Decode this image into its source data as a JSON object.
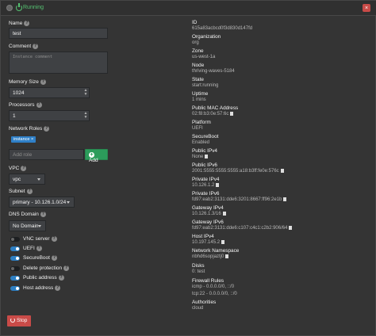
{
  "header": {
    "status": "Running",
    "delete_glyph": "×"
  },
  "form": {
    "name_label": "Name",
    "name_value": "test",
    "comment_label": "Comment",
    "comment_placeholder": "Instance comment",
    "memory_label": "Memory Size",
    "memory_value": "1024",
    "processors_label": "Processors",
    "processors_value": "1",
    "network_roles_label": "Network Roles",
    "role_tag": "instance",
    "role_tag_close": "×",
    "add_role_placeholder": "Add role",
    "add_label": "Add",
    "vpc_label": "VPC",
    "vpc_value": "vpc",
    "subnet_label": "Subnet",
    "subnet_value": "primary - 10.126.1.0/24",
    "dns_domain_label": "DNS Domain",
    "dns_domain_value": "No Domain",
    "toggles": [
      {
        "label": "VNC server",
        "on": false
      },
      {
        "label": "UEFI",
        "on": true
      },
      {
        "label": "SecureBoot",
        "on": true
      },
      {
        "label": "Delete protection",
        "on": false
      },
      {
        "label": "Public address",
        "on": true
      },
      {
        "label": "Host address",
        "on": true
      }
    ],
    "stop_label": "Stop"
  },
  "info": [
    {
      "label": "ID",
      "value": "615a83acbcd0f3d830d147fd"
    },
    {
      "label": "Organization",
      "value": "org"
    },
    {
      "label": "Zone",
      "value": "us-west-1a"
    },
    {
      "label": "Node",
      "value": "thriving-waves-5184"
    },
    {
      "label": "State",
      "value": "start:running"
    },
    {
      "label": "Uptime",
      "value": "1 mins"
    },
    {
      "label": "Public MAC Address",
      "value": "02:f8:b3:0e:57:6c"
    },
    {
      "label": "Platform",
      "value": "UEFI"
    },
    {
      "label": "SecureBoot",
      "value": "Enabled"
    },
    {
      "label": "Public IPv4",
      "value": "None"
    },
    {
      "label": "Public IPv6",
      "value": "2001:5555:5555:5555:a18:b3ff:fe0e:576c"
    },
    {
      "label": "Private IPv4",
      "value": "10.126.1.2"
    },
    {
      "label": "Private IPv6",
      "value": "fd97:eab2:3131:dde6:3201:8667:ff96:2e1b"
    },
    {
      "label": "Gateway IPv4",
      "value": "10.126.1.3/16"
    },
    {
      "label": "Gateway IPv6",
      "value": "fd97:eab2:3131:dde6:c107:c4c1:c2b2:906/64"
    },
    {
      "label": "Host IPv4",
      "value": "10.197.145.2"
    },
    {
      "label": "Network Namespace",
      "value": "nbhd6sopjaztj0"
    },
    {
      "label": "Disks",
      "value": "0: test"
    },
    {
      "label": "Firewall Rules",
      "value": "icmp - 0.0.0.0/0, ::/0"
    },
    {
      "label": "",
      "value": "tcp:22 - 0.0.0.0/0, ::/0"
    },
    {
      "label": "Authorities",
      "value": "cloud"
    }
  ]
}
